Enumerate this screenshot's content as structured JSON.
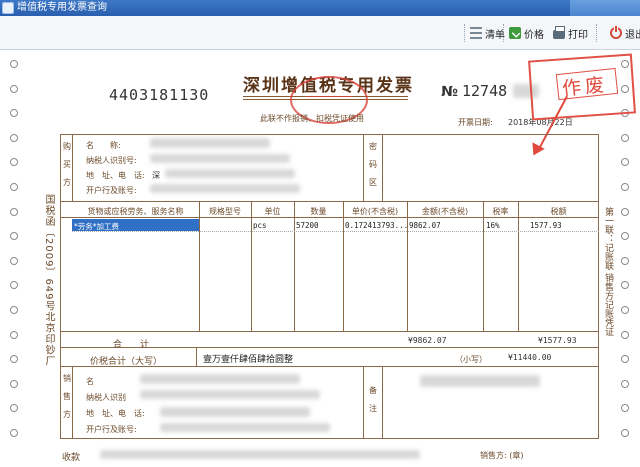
{
  "window": {
    "title": "增值税专用发票查询"
  },
  "toolbar": {
    "clear_label": "清单",
    "price_label": "价格",
    "print_label": "打印",
    "exit_label": "退出"
  },
  "invoice": {
    "code": "4403181130",
    "title": "深圳增值税专用发票",
    "subtitle": "此联不作报销、扣税凭证使用",
    "number_prefix": "№",
    "number": "12748",
    "date_label": "开票日期:",
    "date_value": "2018年08月22日",
    "void_stamp": "作废",
    "side_code": "国税函〔2009〕649号北京印钞厂",
    "side_copy": "第一联：记账联 销售方记账凭证",
    "buyer": {
      "section_label": "购买方",
      "name_label": "名　　称:",
      "tax_id_label": "纳税人识别号:",
      "address_label": "地　址、电　话:",
      "address_partial": "深",
      "bank_label": "开户行及账号:"
    },
    "password_label": "密码区",
    "columns": [
      "货物或应税劳务、服务名称",
      "规格型号",
      "单位",
      "数量",
      "单价(不含税)",
      "金额(不含税)",
      "税率",
      "税额"
    ],
    "items": [
      {
        "name": "*劳务*加工费",
        "spec": "",
        "unit": "pcs",
        "qty": "57200",
        "unit_price": "0.172413793...",
        "amount": "9862.07",
        "rate": "16%",
        "tax": "1577.93"
      }
    ],
    "total_label": "合　　计",
    "total_amount": "¥9862.07",
    "total_tax": "¥1577.93",
    "grand_total_label": "价税合计（大写）",
    "grand_total_words": "壹万壹仟肆佰肆拾圆整",
    "grand_total_small_label": "（小写）",
    "grand_total_small": "¥11440.00",
    "seller": {
      "section_label": "销售方",
      "name_label": "名",
      "tax_id_label": "纳税人识别",
      "address_label": "地　址、电　话:",
      "bank_label": "开户行及账号:"
    },
    "remark_label": "备注",
    "payee_label": "收款",
    "issuer_label": "销售方: (章)"
  }
}
